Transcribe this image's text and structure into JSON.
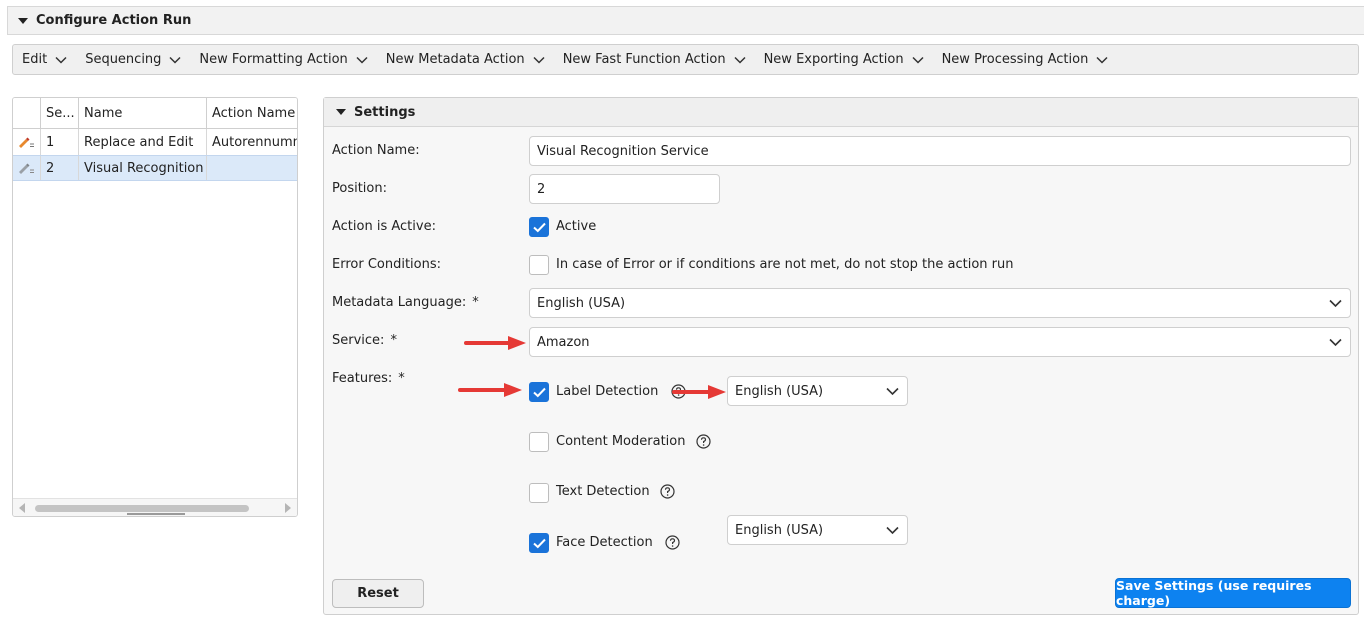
{
  "section": {
    "title": "Configure Action Run"
  },
  "toolbar": {
    "items": [
      {
        "label": "Edit"
      },
      {
        "label": "Sequencing"
      },
      {
        "label": "New Formatting Action"
      },
      {
        "label": "New Metadata Action"
      },
      {
        "label": "New Fast Function Action"
      },
      {
        "label": "New Exporting Action"
      },
      {
        "label": "New Processing Action"
      }
    ]
  },
  "grid": {
    "columns": [
      "Se...",
      "Name",
      "Action Name"
    ],
    "rows": [
      {
        "seq": "1",
        "name": "Replace and Edit",
        "action_name": "Autorennummer",
        "icon": "pencil-edit-icon"
      },
      {
        "seq": "2",
        "name": "Visual Recognition S",
        "action_name": "",
        "icon": "pencil-edit-icon",
        "selected": true
      }
    ]
  },
  "settings": {
    "title": "Settings",
    "action_name": {
      "label": "Action Name:",
      "value": "Visual Recognition Service"
    },
    "position": {
      "label": "Position:",
      "value": "2"
    },
    "active": {
      "label": "Action is Active:",
      "checkbox_label": "Active",
      "checked": true
    },
    "error": {
      "label": "Error Conditions:",
      "checkbox_label": "In case of Error or if conditions are not met, do not stop the action run",
      "checked": false
    },
    "metadata_language": {
      "label": "Metadata Language:",
      "required": "*",
      "value": "English (USA)"
    },
    "service": {
      "label": "Service:",
      "required": "*",
      "value": "Amazon"
    },
    "features": {
      "label": "Features:",
      "required": "*",
      "items": [
        {
          "label": "Label Detection",
          "checked": true,
          "language": "English (USA)"
        },
        {
          "label": "Content Moderation",
          "checked": false
        },
        {
          "label": "Text Detection",
          "checked": false
        },
        {
          "label": "Face Detection",
          "checked": true,
          "language": "English (USA)"
        }
      ]
    },
    "reset_label": "Reset",
    "save_label": "Save Settings (use requires charge)"
  },
  "colors": {
    "accent": "#1a73d9",
    "save_button": "#0d82f0",
    "selected_row": "#dbe9f9",
    "arrow": "#e53935"
  }
}
